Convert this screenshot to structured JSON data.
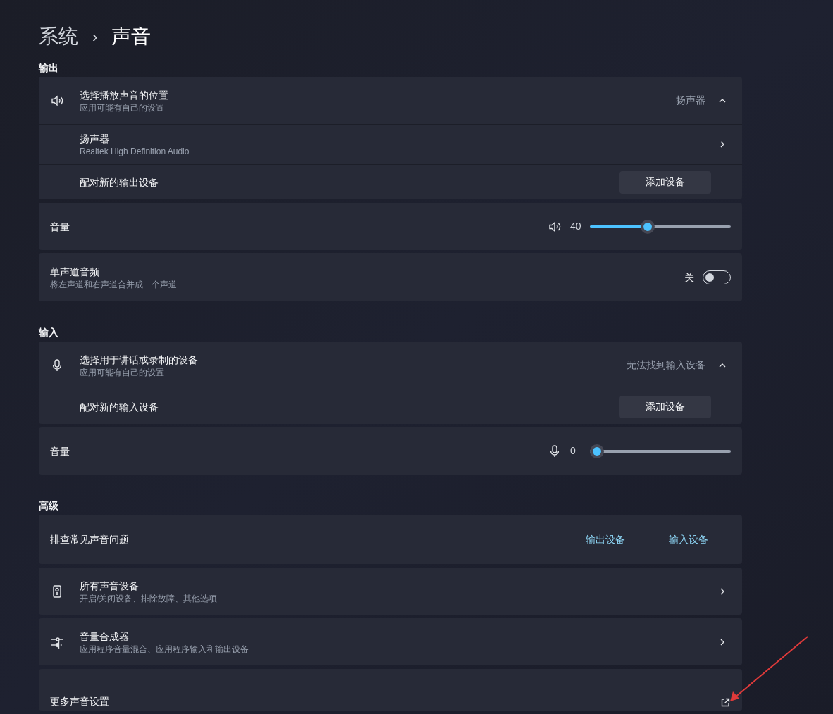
{
  "breadcrumb": {
    "parent": "系统",
    "separator": "›",
    "current": "声音"
  },
  "sections": [
    {
      "heading": "输出",
      "cards": [
        {
          "rows": [
            {
              "kind": "expander",
              "title": "选择播放声音的位置",
              "subtitle": "应用可能有自己的设置",
              "value": "扬声器",
              "expanded": true
            },
            {
              "kind": "nav",
              "title": "扬声器",
              "subtitle": "Realtek High Definition Audio"
            },
            {
              "kind": "button",
              "title": "配对新的输出设备",
              "button": "添加设备"
            }
          ]
        },
        {
          "rows": [
            {
              "kind": "slider",
              "title": "音量",
              "reading": "40",
              "level": 0.4
            }
          ]
        },
        {
          "rows": [
            {
              "kind": "toggle",
              "title": "单声道音频",
              "subtitle": "将左声道和右声道合并成一个声道",
              "state_label": "关",
              "on": false
            }
          ]
        }
      ]
    },
    {
      "heading": "输入",
      "cards": [
        {
          "rows": [
            {
              "kind": "expander",
              "title": "选择用于讲话或录制的设备",
              "subtitle": "应用可能有自己的设置",
              "value": "无法找到输入设备",
              "expanded": true
            },
            {
              "kind": "button",
              "title": "配对新的输入设备",
              "button": "添加设备"
            }
          ]
        },
        {
          "rows": [
            {
              "kind": "slider",
              "title": "音量",
              "reading": "0",
              "level": 0
            }
          ]
        }
      ]
    },
    {
      "heading": "高级",
      "cards": [
        {
          "rows": [
            {
              "kind": "links",
              "title": "排查常见声音问题",
              "links": [
                "输出设备",
                "输入设备"
              ]
            }
          ]
        },
        {
          "rows": [
            {
              "kind": "nav",
              "title": "所有声音设备",
              "subtitle": "开启/关闭设备、排除故障、其他选项"
            }
          ]
        },
        {
          "rows": [
            {
              "kind": "nav",
              "title": "音量合成器",
              "subtitle": "应用程序音量混合、应用程序输入和输出设备"
            }
          ]
        },
        {
          "rows": [
            {
              "kind": "external",
              "title": "更多声音设置"
            }
          ]
        }
      ]
    }
  ]
}
